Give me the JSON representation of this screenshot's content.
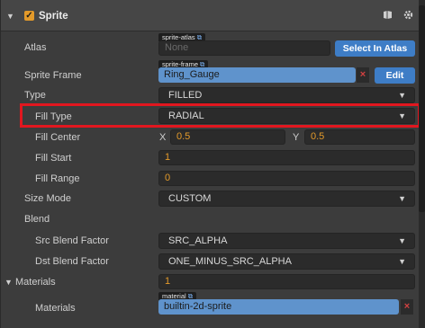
{
  "component": {
    "title": "Sprite",
    "enabled": true,
    "book_icon": "book-icon",
    "gear_icon": "gear-icon"
  },
  "atlas": {
    "label": "Atlas",
    "tag": "sprite-atlas",
    "value": "None",
    "button": "Select In Atlas"
  },
  "sprite_frame": {
    "label": "Sprite Frame",
    "tag": "sprite-frame",
    "value": "Ring_Gauge",
    "clear": "×",
    "button": "Edit"
  },
  "type": {
    "label": "Type",
    "value": "FILLED"
  },
  "fill_type": {
    "label": "Fill Type",
    "value": "RADIAL"
  },
  "fill_center": {
    "label": "Fill Center",
    "x_label": "X",
    "x": "0.5",
    "y_label": "Y",
    "y": "0.5"
  },
  "fill_start": {
    "label": "Fill Start",
    "value": "1"
  },
  "fill_range": {
    "label": "Fill Range",
    "value": "0"
  },
  "size_mode": {
    "label": "Size Mode",
    "value": "CUSTOM"
  },
  "blend": {
    "label": "Blend"
  },
  "src_blend": {
    "label": "Src Blend Factor",
    "value": "SRC_ALPHA"
  },
  "dst_blend": {
    "label": "Dst Blend Factor",
    "value": "ONE_MINUS_SRC_ALPHA"
  },
  "materials_group": {
    "label": "Materials",
    "count": "1"
  },
  "materials_item": {
    "label": "Materials",
    "tag": "material",
    "value": "builtin-2d-sprite",
    "clear": "×"
  },
  "colors": {
    "accent_orange": "#e39a2a",
    "asset_blue": "#5f93cc",
    "button_blue": "#3e7dc6",
    "highlight_red": "#e2171f",
    "clear_red": "#d24141"
  }
}
